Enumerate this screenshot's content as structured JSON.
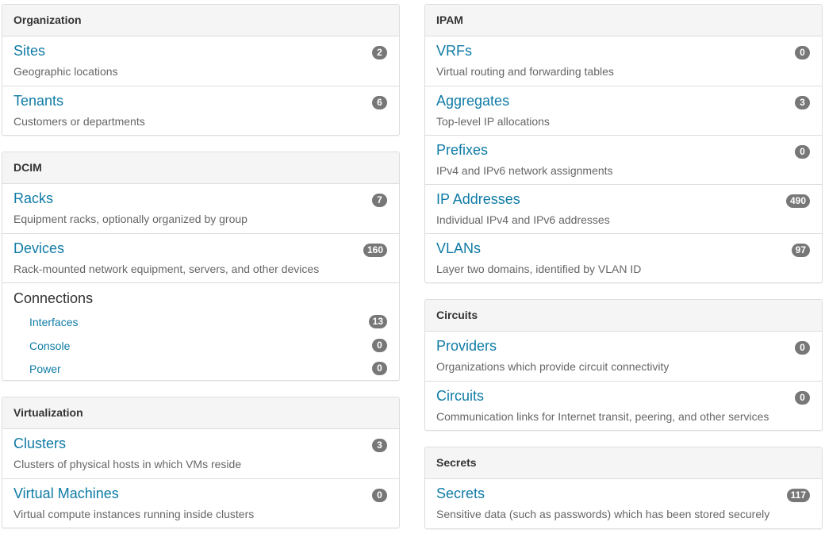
{
  "organization": {
    "heading": "Organization",
    "items": [
      {
        "title": "Sites",
        "desc": "Geographic locations",
        "count": "2"
      },
      {
        "title": "Tenants",
        "desc": "Customers or departments",
        "count": "6"
      }
    ]
  },
  "dcim": {
    "heading": "DCIM",
    "items": [
      {
        "title": "Racks",
        "desc": "Equipment racks, optionally organized by group",
        "count": "7"
      },
      {
        "title": "Devices",
        "desc": "Rack-mounted network equipment, servers, and other devices",
        "count": "160"
      }
    ],
    "connections": {
      "title": "Connections",
      "items": [
        {
          "label": "Interfaces",
          "count": "13"
        },
        {
          "label": "Console",
          "count": "0"
        },
        {
          "label": "Power",
          "count": "0"
        }
      ]
    }
  },
  "virtualization": {
    "heading": "Virtualization",
    "items": [
      {
        "title": "Clusters",
        "desc": "Clusters of physical hosts in which VMs reside",
        "count": "3"
      },
      {
        "title": "Virtual Machines",
        "desc": "Virtual compute instances running inside clusters",
        "count": "0"
      }
    ]
  },
  "ipam": {
    "heading": "IPAM",
    "items": [
      {
        "title": "VRFs",
        "desc": "Virtual routing and forwarding tables",
        "count": "0"
      },
      {
        "title": "Aggregates",
        "desc": "Top-level IP allocations",
        "count": "3"
      },
      {
        "title": "Prefixes",
        "desc": "IPv4 and IPv6 network assignments",
        "count": "0"
      },
      {
        "title": "IP Addresses",
        "desc": "Individual IPv4 and IPv6 addresses",
        "count": "490"
      },
      {
        "title": "VLANs",
        "desc": "Layer two domains, identified by VLAN ID",
        "count": "97"
      }
    ]
  },
  "circuits": {
    "heading": "Circuits",
    "items": [
      {
        "title": "Providers",
        "desc": "Organizations which provide circuit connectivity",
        "count": "0"
      },
      {
        "title": "Circuits",
        "desc": "Communication links for Internet transit, peering, and other services",
        "count": "0"
      }
    ]
  },
  "secrets": {
    "heading": "Secrets",
    "items": [
      {
        "title": "Secrets",
        "desc": "Sensitive data (such as passwords) which has been stored securely",
        "count": "117"
      }
    ]
  }
}
